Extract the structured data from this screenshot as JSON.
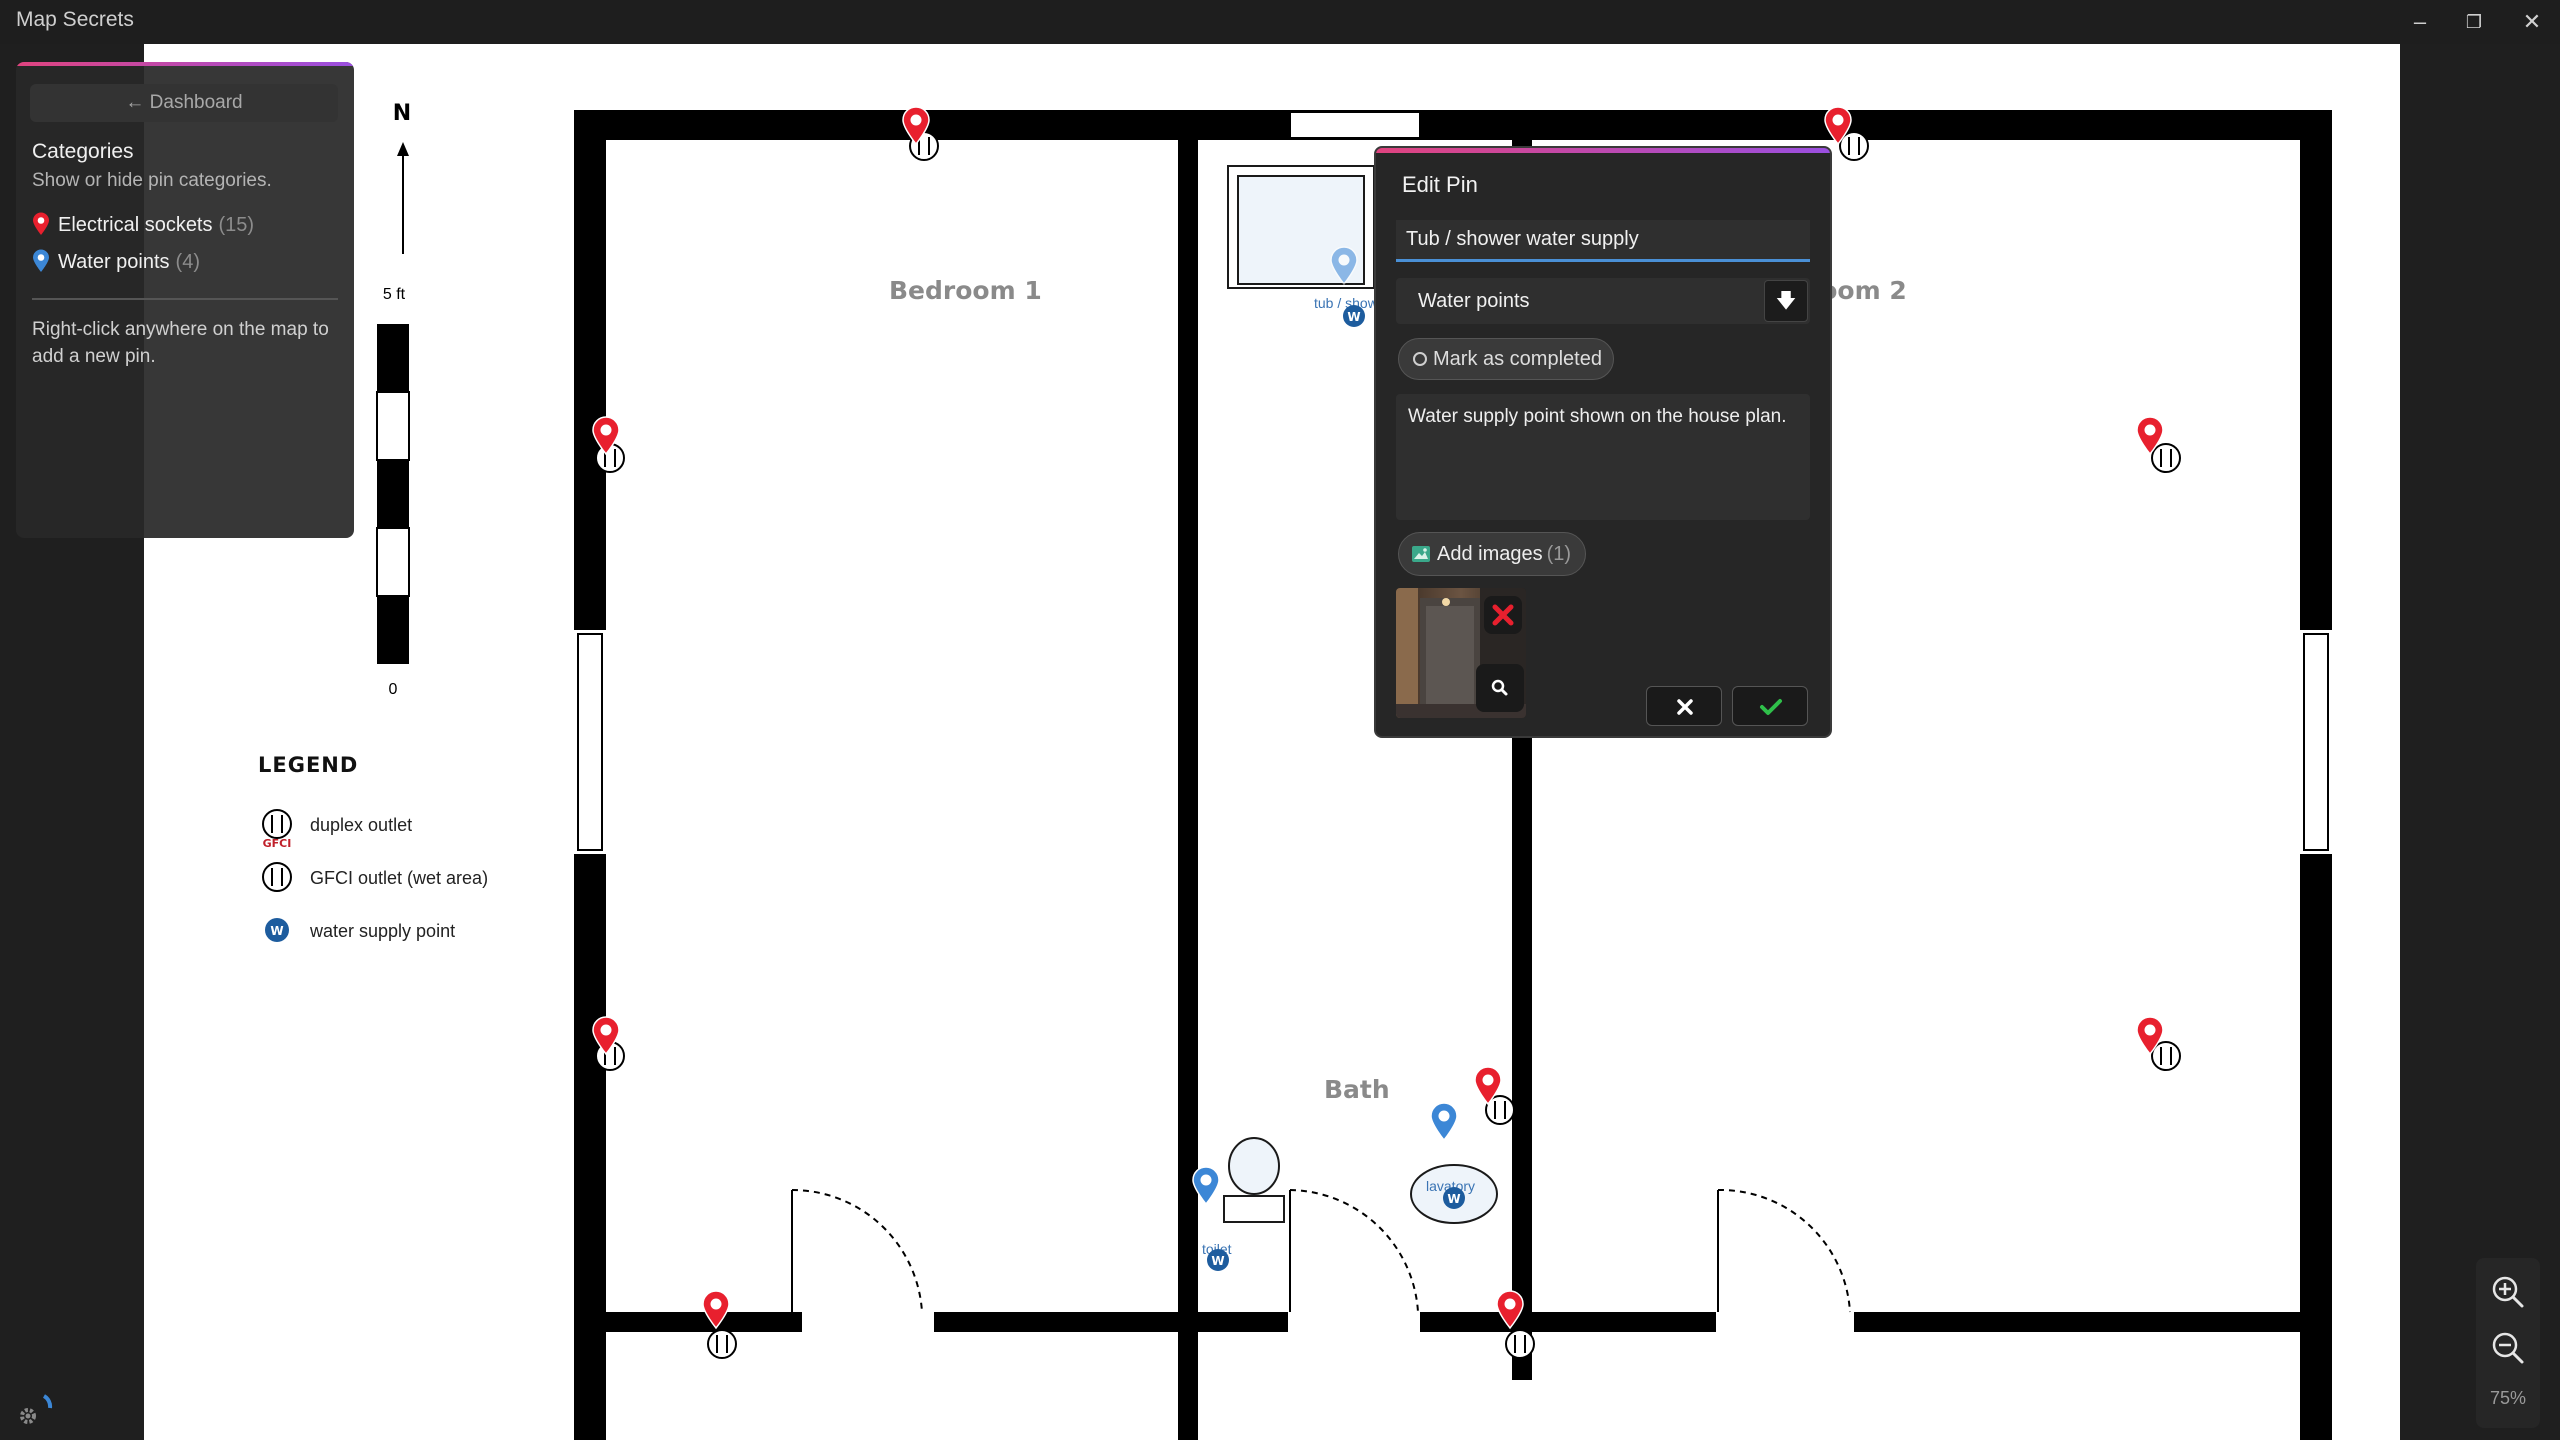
{
  "window": {
    "title": "Map Secrets",
    "controls": {
      "minimize": "–",
      "restore": "❐",
      "close": "✕"
    }
  },
  "sidebar": {
    "dashboard_label": "← Dashboard",
    "heading": "Categories",
    "subheading": "Show or hide pin categories.",
    "categories": [
      {
        "label": "Electrical sockets",
        "count": "(15)",
        "color": "#e8202e"
      },
      {
        "label": "Water points",
        "count": "(4)",
        "color": "#3c87d6"
      }
    ],
    "hint": "Right-click anywhere on the map to add a new pin."
  },
  "map": {
    "rooms": {
      "bedroom1": "Bedroom 1",
      "bedroom2": "Bedroom 2",
      "bath": "Bath"
    },
    "fixtures": {
      "tub": "tub / shower",
      "toilet": "toilet",
      "lavatory": "lavatory"
    },
    "compass": "N",
    "scale": {
      "top": "5 ft",
      "bottom": "0"
    },
    "symbols": {
      "water": "W",
      "gfci": "GFCI"
    },
    "legend": {
      "title": "LEGEND",
      "items": [
        "duplex outlet",
        "GFCI outlet (wet area)",
        "water supply point"
      ]
    }
  },
  "edit_pin": {
    "title": "Edit Pin",
    "name_value": "Tub / shower water supply",
    "category_value": "Water points",
    "complete_label": "Mark as completed",
    "notes_value": "Water supply point shown on the house plan.",
    "add_images_label": "Add images",
    "add_images_count": "(1)"
  },
  "zoom": {
    "level": "75%"
  },
  "colors": {
    "socket": "#e8202e",
    "water": "#3c87d6",
    "accent": "#4a90d6",
    "confirm": "#2fbf4a"
  }
}
